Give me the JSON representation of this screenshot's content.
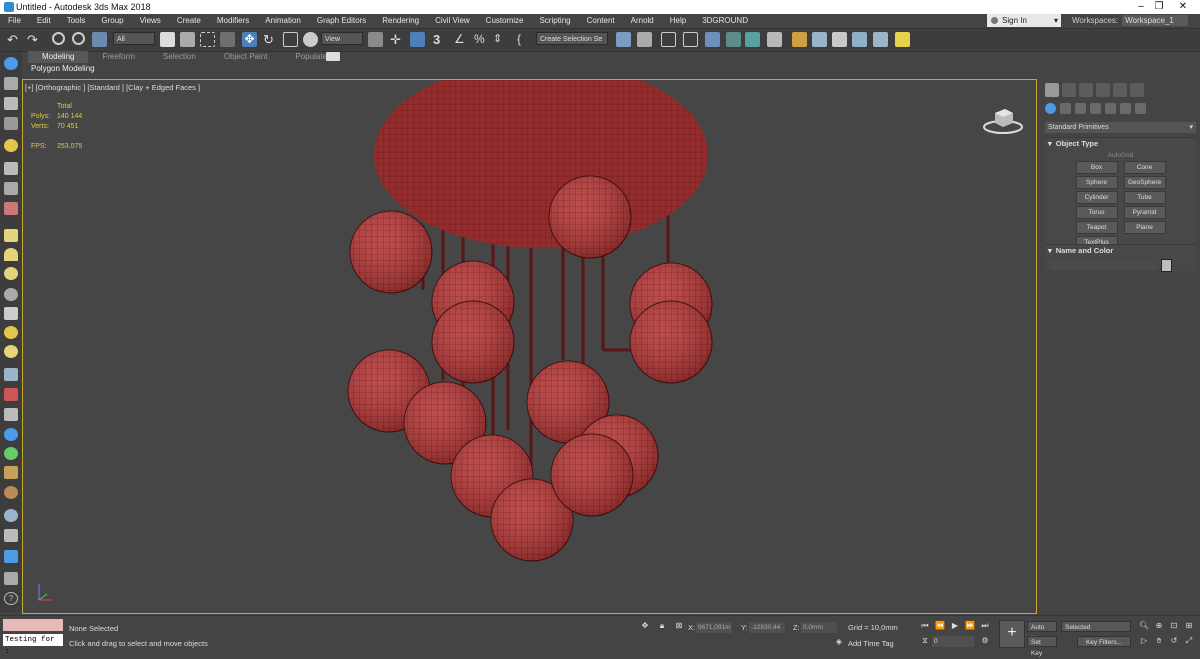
{
  "window": {
    "title": "Untitled - Autodesk 3ds Max 2018",
    "minimize": "–",
    "maximize": "❐",
    "close": "✕"
  },
  "menu": [
    "File",
    "Edit",
    "Tools",
    "Group",
    "Views",
    "Create",
    "Modifiers",
    "Animation",
    "Graph Editors",
    "Rendering",
    "Civil View",
    "Customize",
    "Scripting",
    "Content",
    "Arnold",
    "Help",
    "3DGROUND"
  ],
  "account": {
    "signin": "Sign In",
    "workspaces_label": "Workspaces:",
    "workspace": "Workspace_1"
  },
  "toolbar": {
    "filter": "All",
    "view": "View",
    "selection_set": "Create Selection Se",
    "snap_3": "3",
    "snap_pct": "%"
  },
  "ribbon": {
    "tabs": [
      "Modeling",
      "Freeform",
      "Selection",
      "Object Paint",
      "Populate"
    ],
    "active_tab": "Modeling",
    "panel_label": "Polygon Modeling"
  },
  "viewport": {
    "label": "[+] [Orthographic ] [Standard ] [Clay + Edged Faces ]",
    "stats": {
      "total_label": "Total",
      "polys_label": "Polys:",
      "polys": "140 144",
      "verts_label": "Verts:",
      "verts": "70 451",
      "fps_label": "FPS:",
      "fps": "253,075"
    }
  },
  "command_panel": {
    "category": "Standard Primitives",
    "object_type": "Object Type",
    "autogrid": "AutoGrid",
    "primitives": [
      "Box",
      "Cone",
      "Sphere",
      "GeoSphere",
      "Cylinder",
      "Tube",
      "Torus",
      "Pyramid",
      "Teapot",
      "Plane",
      "TextPlus"
    ],
    "name_and_color": "Name and Color"
  },
  "status": {
    "maxscript_input": "Testing for :",
    "selection": "None Selected",
    "prompt": "Click and drag to select and move objects",
    "x_label": "X:",
    "x_value": "9671,091m",
    "y_label": "Y:",
    "y_value": "-12830,44",
    "z_label": "Z:",
    "z_value": "0,0mm",
    "grid": "Grid = 10,0mm",
    "add_time_tag": "Add Time Tag",
    "auto_key": "Auto Key",
    "set_key": "Set Key",
    "key_mode": "Selected",
    "key_filters": "Key Filters...",
    "frame": "0"
  },
  "colors": {
    "accent": "#4d9be6",
    "mesh_red": "#b03a3a",
    "viewport_border": "#c8aa2a",
    "stats_yellow": "#e3c64b"
  }
}
